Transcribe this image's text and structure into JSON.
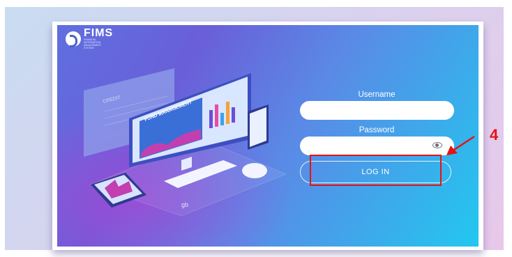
{
  "logo": {
    "name": "FIMS",
    "subtitle": "FINANCIAL INFORMATION MANAGEMENT SYSTEM"
  },
  "illustration": {
    "board_label": "FUND MANAGEMENT",
    "panel_label": "CREDIT",
    "badge": "gb"
  },
  "form": {
    "username_label": "Username",
    "password_label": "Password",
    "login_label": "LOG IN"
  },
  "annotation": {
    "step": "4",
    "color": "#e41414"
  },
  "colors": {
    "gradient_start": "#6a5fd8",
    "gradient_end": "#22c7ef"
  }
}
